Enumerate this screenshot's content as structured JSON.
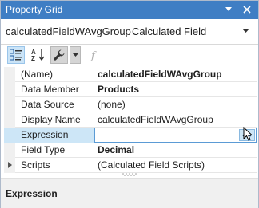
{
  "window": {
    "title": "Property Grid"
  },
  "selector": {
    "name": "calculatedFieldWAvgGroup",
    "type": "Calculated Field"
  },
  "toolbar": {
    "categorized": "categorized-icon",
    "alphabetical": "sort-az-icon",
    "properties": "wrench-icon",
    "events": "fx-icon"
  },
  "rows": [
    {
      "name": "(Name)",
      "value": "calculatedFieldWAvgGroup"
    },
    {
      "name": "Data Member",
      "value": "Products"
    },
    {
      "name": "Data Source",
      "value": "(none)"
    },
    {
      "name": "Display Name",
      "value": "calculatedFieldWAvgGroup"
    },
    {
      "name": "Expression",
      "value": ""
    },
    {
      "name": "Field Type",
      "value": "Decimal"
    },
    {
      "name": "Scripts",
      "value": "(Calculated Field Scripts)"
    }
  ],
  "description": {
    "title": "Expression"
  },
  "colors": {
    "titlebar": "#3f7ec4",
    "selection": "#cde6f7",
    "accent": "#5b9bd5"
  }
}
